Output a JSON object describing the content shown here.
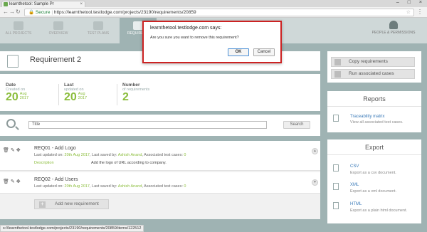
{
  "browser": {
    "tab_title": "learnthetool: Sample Pr",
    "tab_close": "×",
    "window_controls": "– □ ×",
    "secure_label": "Secure",
    "url": "https://learnthetool.testlodge.com/projects/23190/requirements/20859",
    "status_url": "s://learnthetool.testlodge.com/projects/23190/requirements/20859/items/122512"
  },
  "nav": {
    "items": [
      {
        "label": "ALL PROJECTS"
      },
      {
        "label": "OVERVIEW"
      },
      {
        "label": "TEST PLANS"
      },
      {
        "label": "REQUIREME"
      }
    ],
    "people_label": "PEOPLE & PERMISSIONS"
  },
  "requirement": {
    "title": "Requirement 2"
  },
  "stats": {
    "date": {
      "label": "Date",
      "sub": "Created on",
      "day": "20",
      "month": "Aug",
      "year": "2017"
    },
    "last": {
      "label": "Last",
      "sub": "updated on",
      "day": "20",
      "month": "Aug",
      "year": "2017"
    },
    "number": {
      "label": "Number",
      "sub": "of requirements",
      "value": "2"
    }
  },
  "search": {
    "placeholder": "Title",
    "button": "Search"
  },
  "requirements": [
    {
      "title": "REQ01 - Add Logo",
      "meta_prefix": "Last updated on:",
      "date": "20th Aug 2017",
      "saved_by_prefix": ", Last saved by:",
      "saved_by": "Ashish Anand",
      "cases_prefix": ", Associated test cases:",
      "cases": "0",
      "desc_label": "Description",
      "desc_text": "Add the logo of URL according to company."
    },
    {
      "title": "REQ02 - Add Users",
      "meta_prefix": "Last updated on:",
      "date": "20th Aug 2017",
      "saved_by_prefix": ", Last saved by:",
      "saved_by": "Ashish Anand",
      "cases_prefix": ", Associated test cases:",
      "cases": "0"
    }
  ],
  "add_button": "Add new requirement",
  "actions": {
    "copy": "Copy requirements",
    "run": "Run associated cases"
  },
  "reports": {
    "title": "Reports",
    "link": "Traceability matrix",
    "desc": "View all associated test cases."
  },
  "export": {
    "title": "Export",
    "items": [
      {
        "link": "CSV",
        "desc": "Export as a csv document."
      },
      {
        "link": "XML",
        "desc": "Export as a xml document."
      },
      {
        "link": "HTML",
        "desc": "Export as a plain html document."
      }
    ]
  },
  "dialog": {
    "title": "learnthetool.testlodge.com says:",
    "message": "Are you sure you want to remove this requirement?",
    "ok": "OK",
    "cancel": "Cancel"
  },
  "colors": {
    "accent_green": "#8bbd3c",
    "dialog_border": "#cc2222",
    "link_blue": "#3a7ab8"
  }
}
